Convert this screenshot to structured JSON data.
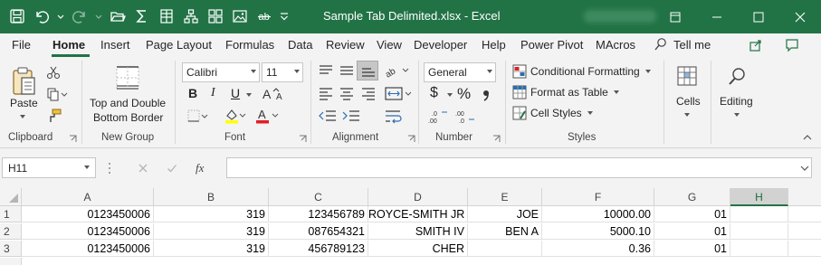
{
  "window": {
    "title": "Sample Tab Delimited.xlsx  -  Excel"
  },
  "menu": {
    "tabs": [
      "File",
      "Home",
      "Insert",
      "Page Layout",
      "Formulas",
      "Data",
      "Review",
      "View",
      "Developer",
      "Help",
      "Power Pivot",
      "MAcros"
    ],
    "active": "Home",
    "tell_me": "Tell me"
  },
  "ribbon": {
    "clipboard": {
      "label": "Clipboard",
      "paste": "Paste"
    },
    "new_group": {
      "label": "New Group",
      "button_line1": "Top and Double",
      "button_line2": "Bottom Border"
    },
    "font": {
      "label": "Font",
      "name": "Calibri",
      "size": "11",
      "bold": "B",
      "italic": "I",
      "underline": "U",
      "font_color": "#e51c23",
      "highlight_color": "#ffff00"
    },
    "alignment": {
      "label": "Alignment"
    },
    "number": {
      "label": "Number",
      "format": "General",
      "currency": "$",
      "percent": "%",
      "comma": "̩"
    },
    "styles": {
      "label": "Styles",
      "conditional": "Conditional Formatting",
      "format_table": "Format as Table",
      "cell_styles": "Cell Styles"
    },
    "cells": {
      "label": "Cells"
    },
    "editing": {
      "label": "Editing"
    }
  },
  "formula_bar": {
    "name_box": "H11",
    "fx": "fx",
    "content": ""
  },
  "sheet": {
    "columns": [
      "A",
      "B",
      "C",
      "D",
      "E",
      "F",
      "G",
      "H"
    ],
    "selected_column": "H",
    "rows": [
      {
        "num": "1",
        "cells": [
          "0123450006",
          "319",
          "123456789",
          "ROYCE-SMITH JR",
          "JOE",
          "10000.00",
          "01",
          ""
        ]
      },
      {
        "num": "2",
        "cells": [
          "0123450006",
          "319",
          "087654321",
          "SMITH IV",
          "BEN A",
          "5000.10",
          "01",
          ""
        ]
      },
      {
        "num": "3",
        "cells": [
          "0123450006",
          "319",
          "456789123",
          "CHER",
          "",
          "0.36",
          "01",
          ""
        ]
      }
    ]
  },
  "colors": {
    "accent": "#217346"
  }
}
